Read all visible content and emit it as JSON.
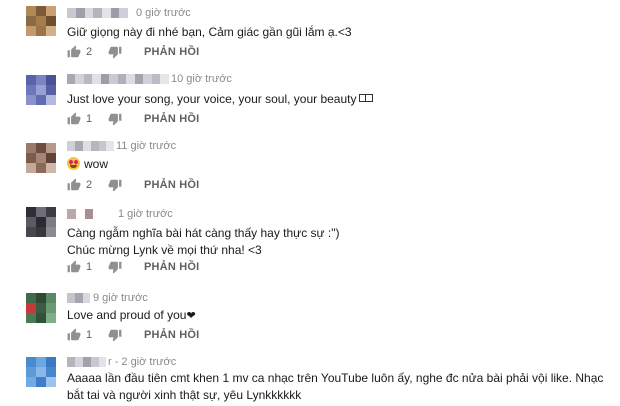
{
  "comments": [
    {
      "time": "0 giờ trước",
      "lines": [
        "Giữ giọng này đi nhé bạn, Cảm giác gần gũi lắm ạ.<3"
      ],
      "likes": "2",
      "reply": "PHẢN HỒI"
    },
    {
      "time": "10 giờ trước",
      "lines": [
        "Just love your song, your voice, your soul, your beauty"
      ],
      "likes": "1",
      "reply": "PHẢN HỒI"
    },
    {
      "time": "11 giờ trước",
      "lines": [
        "wow"
      ],
      "likes": "2",
      "reply": "PHẢN HỒI"
    },
    {
      "time": "1 giờ trước",
      "lines": [
        "Càng ngẫm nghĩa bài hát càng thấy hay thực sự :\")",
        "Chúc mừng Lynk về mọi thứ nha! <3"
      ],
      "likes": "1",
      "reply": "PHẢN HỒI"
    },
    {
      "time": "9 giờ trước",
      "lines": [
        "Love and proud of you"
      ],
      "likes": "1",
      "reply": "PHẢN HỒI"
    },
    {
      "time": "2 giờ trước",
      "author_suffix": "r -",
      "lines": [
        "Aaaaa lần đầu tiên cmt khen 1 mv ca nhạc trên YouTube luôn ấy, nghe đc nửa bài phải vội like. Nhạc bắt tai và người xinh thật sự, yêu Lynkkkkkk"
      ]
    }
  ],
  "icons": {
    "like": "thumbs-up-icon",
    "dislike": "thumbs-down-icon",
    "heart": "heart-icon",
    "emoji": "heart-eyes-emoji-icon"
  },
  "colors": {
    "meta": "#8a8a8a",
    "action": "#606060",
    "text": "#1a1a1a"
  }
}
